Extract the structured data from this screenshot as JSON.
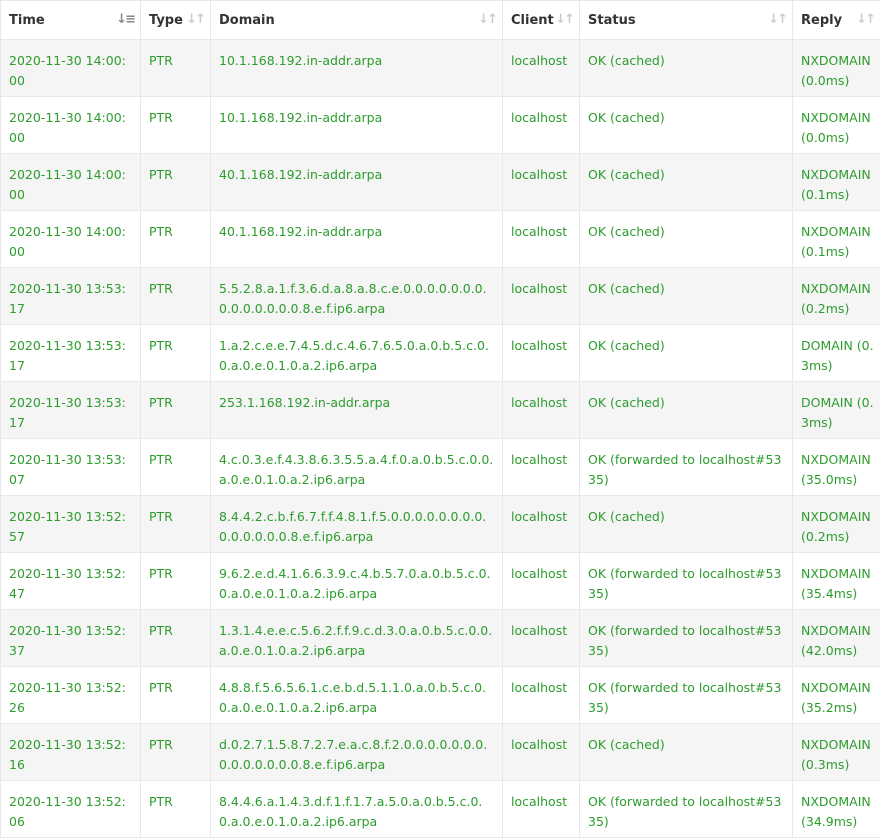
{
  "table": {
    "headers": [
      {
        "label": "Time",
        "sort": "sort-desc-icon",
        "active": true
      },
      {
        "label": "Type",
        "sort": "sort-icon",
        "active": false
      },
      {
        "label": "Domain",
        "sort": "sort-icon",
        "active": false
      },
      {
        "label": "Client",
        "sort": "sort-icon",
        "active": false
      },
      {
        "label": "Status",
        "sort": "sort-icon",
        "active": false
      },
      {
        "label": "Reply",
        "sort": "sort-icon",
        "active": false
      }
    ],
    "rows": [
      {
        "time": "2020-11-30 14:00:00",
        "type": "PTR",
        "domain": "10.1.168.192.in-addr.arpa",
        "client": "localhost",
        "status": "OK (cached)",
        "reply": "NXDOMAIN (0.0ms)"
      },
      {
        "time": "2020-11-30 14:00:00",
        "type": "PTR",
        "domain": "10.1.168.192.in-addr.arpa",
        "client": "localhost",
        "status": "OK (cached)",
        "reply": "NXDOMAIN (0.0ms)"
      },
      {
        "time": "2020-11-30 14:00:00",
        "type": "PTR",
        "domain": "40.1.168.192.in-addr.arpa",
        "client": "localhost",
        "status": "OK (cached)",
        "reply": "NXDOMAIN (0.1ms)"
      },
      {
        "time": "2020-11-30 14:00:00",
        "type": "PTR",
        "domain": "40.1.168.192.in-addr.arpa",
        "client": "localhost",
        "status": "OK (cached)",
        "reply": "NXDOMAIN (0.1ms)"
      },
      {
        "time": "2020-11-30 13:53:17",
        "type": "PTR",
        "domain": "5.5.2.8.a.1.f.3.6.d.a.8.a.8.c.e.0.0.0.0.0.0.0.0.0.0.0.0.0.0.8.e.f.ip6.arpa",
        "client": "localhost",
        "status": "OK (cached)",
        "reply": "NXDOMAIN (0.2ms)"
      },
      {
        "time": "2020-11-30 13:53:17",
        "type": "PTR",
        "domain": "1.a.2.c.e.e.7.4.5.d.c.4.6.7.6.5.0.a.0.b.5.c.0.0.a.0.e.0.1.0.a.2.ip6.arpa",
        "client": "localhost",
        "status": "OK (cached)",
        "reply": "DOMAIN (0.3ms)"
      },
      {
        "time": "2020-11-30 13:53:17",
        "type": "PTR",
        "domain": "253.1.168.192.in-addr.arpa",
        "client": "localhost",
        "status": "OK (cached)",
        "reply": "DOMAIN (0.3ms)"
      },
      {
        "time": "2020-11-30 13:53:07",
        "type": "PTR",
        "domain": "4.c.0.3.e.f.4.3.8.6.3.5.5.a.4.f.0.a.0.b.5.c.0.0.a.0.e.0.1.0.a.2.ip6.arpa",
        "client": "localhost",
        "status": "OK (forwarded to localhost#5335)",
        "reply": "NXDOMAIN (35.0ms)"
      },
      {
        "time": "2020-11-30 13:52:57",
        "type": "PTR",
        "domain": "8.4.4.2.c.b.f.6.7.f.f.4.8.1.f.5.0.0.0.0.0.0.0.0.0.0.0.0.0.0.8.e.f.ip6.arpa",
        "client": "localhost",
        "status": "OK (cached)",
        "reply": "NXDOMAIN (0.2ms)"
      },
      {
        "time": "2020-11-30 13:52:47",
        "type": "PTR",
        "domain": "9.6.2.e.d.4.1.6.6.3.9.c.4.b.5.7.0.a.0.b.5.c.0.0.a.0.e.0.1.0.a.2.ip6.arpa",
        "client": "localhost",
        "status": "OK (forwarded to localhost#5335)",
        "reply": "NXDOMAIN (35.4ms)"
      },
      {
        "time": "2020-11-30 13:52:37",
        "type": "PTR",
        "domain": "1.3.1.4.e.e.c.5.6.2.f.f.9.c.d.3.0.a.0.b.5.c.0.0.a.0.e.0.1.0.a.2.ip6.arpa",
        "client": "localhost",
        "status": "OK (forwarded to localhost#5335)",
        "reply": "NXDOMAIN (42.0ms)"
      },
      {
        "time": "2020-11-30 13:52:26",
        "type": "PTR",
        "domain": "4.8.8.f.5.6.5.6.1.c.e.b.d.5.1.1.0.a.0.b.5.c.0.0.a.0.e.0.1.0.a.2.ip6.arpa",
        "client": "localhost",
        "status": "OK (forwarded to localhost#5335)",
        "reply": "NXDOMAIN (35.2ms)"
      },
      {
        "time": "2020-11-30 13:52:16",
        "type": "PTR",
        "domain": "d.0.2.7.1.5.8.7.2.7.e.a.c.8.f.2.0.0.0.0.0.0.0.0.0.0.0.0.0.0.8.e.f.ip6.arpa",
        "client": "localhost",
        "status": "OK (cached)",
        "reply": "NXDOMAIN (0.3ms)"
      },
      {
        "time": "2020-11-30 13:52:06",
        "type": "PTR",
        "domain": "8.4.4.6.a.1.4.3.d.f.1.f.1.7.a.5.0.a.0.b.5.c.0.0.a.0.e.0.1.0.a.2.ip6.arpa",
        "client": "localhost",
        "status": "OK (forwarded to localhost#5335)",
        "reply": "NXDOMAIN (34.9ms)"
      }
    ]
  },
  "colors": {
    "text_ok": "#2d9c2d",
    "header_text": "#333333",
    "row_stripe": "#f5f5f5",
    "border": "#e8e8e8"
  }
}
